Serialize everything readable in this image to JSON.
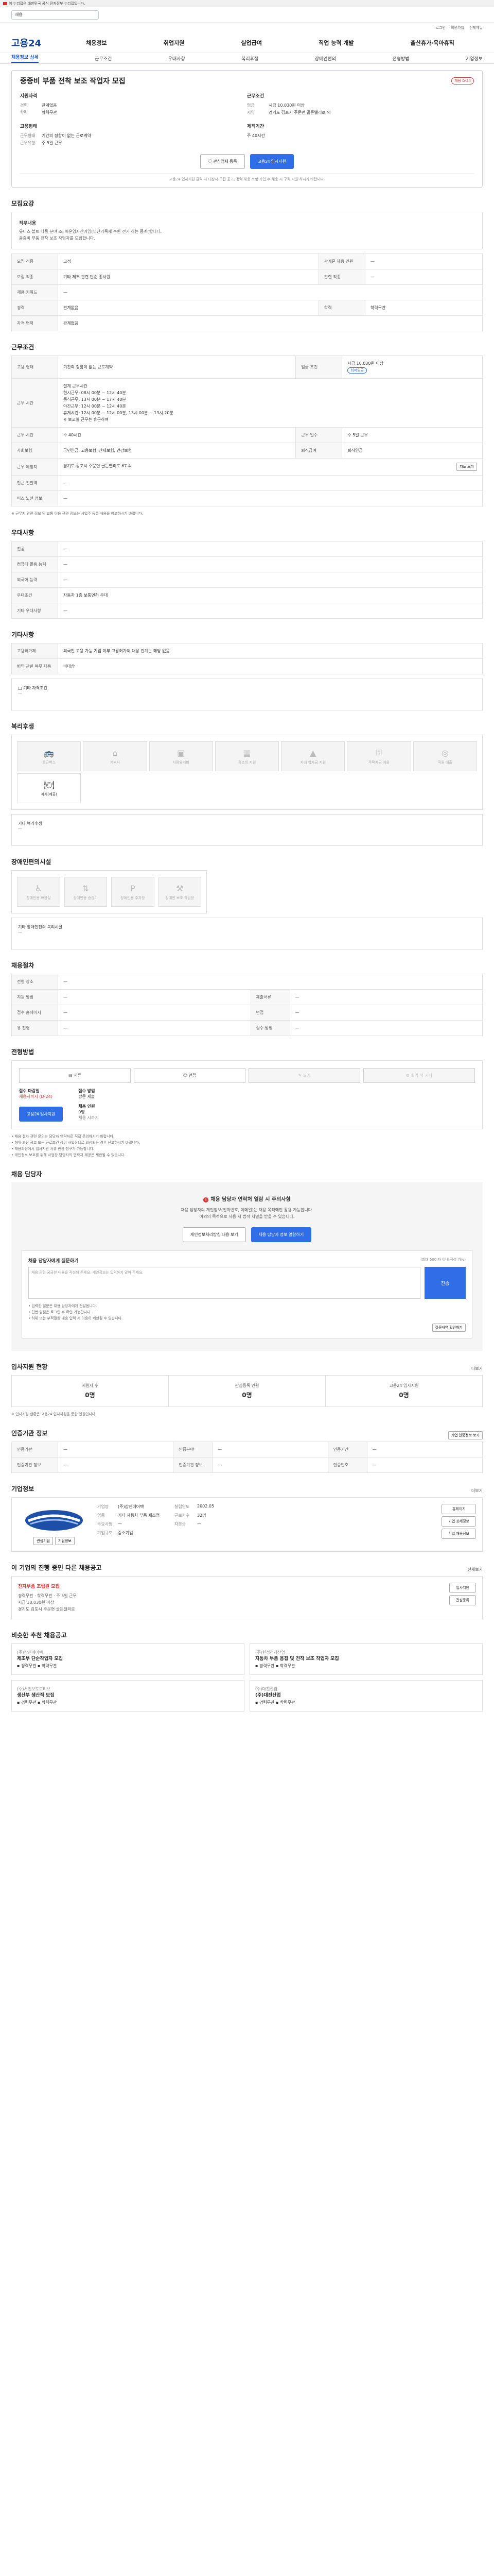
{
  "gov_notice": "이 누리집은 대한민국 공식 전자정부 누리집입니다.",
  "search": {
    "placeholder": "채용"
  },
  "util": [
    "로그인",
    "회원가입",
    "전체메뉴"
  ],
  "logo": "고용24",
  "gnb": [
    "채용정보",
    "취업지원",
    "실업급여",
    "직업 능력 개발",
    "출산휴가·육아휴직"
  ],
  "sub_tabs": [
    "채용정보 상세",
    "근무조건",
    "우대사항",
    "복리후생",
    "장애인편의",
    "전형방법",
    "기업정보"
  ],
  "job": {
    "title": "중증비 부품 전착 보조 작업자 모집",
    "badge": "채용 D-24",
    "col1_title": "지원자격",
    "exp_k": "경력",
    "exp_v": "관계없음",
    "edu_k": "학력",
    "edu_v": "학력무관",
    "form_title": "고용형태",
    "form_k": "근무형태",
    "form_v": "기간의 정함이 없는 근로계약",
    "type_k": "근무유형",
    "type_v": "주 5일 근무",
    "col2_title": "근무조건",
    "pay_k": "임금",
    "pay_v": "시급 10,030원 이상",
    "loc_k": "지역",
    "loc_v": "경기도 김포시 주문면 골든밸리로 외",
    "time_title": "제직기간",
    "time_v": "주 40시간",
    "fav_btn": "관심업체 등록",
    "apply_btn": "고용24 입사지원",
    "note": "고용24 입사지원 클릭 시 대상자 모집 공고, 경력 채용 보험 가입 후 채용 시 구직 지원 하시기 바랍니다."
  },
  "detail": {
    "title": "모집요강",
    "panel_t": "직무내용",
    "panel_p1": "유니스 볼트 다품 분야 조, 비운영자산기입(부산기록제 수한 전기 하는 중계(합니다.",
    "panel_p2": "중증비 부품 전착 보조 작업자를 모집합니다.",
    "rows": [
      {
        "k": "모집 직종",
        "v": "고정",
        "k2": "관계된 채용 인원",
        "v2": "—"
      },
      {
        "k": "모집 직종",
        "v": "기타 제조 관련 단순 종사원",
        "k2": "관련 직종",
        "v2": "—"
      },
      {
        "k": "채용 키워드",
        "v": "—",
        "k2": "",
        "v2": ""
      },
      {
        "k": "경력",
        "v": "관계없음",
        "k2": "학력",
        "v2": "학력무관"
      },
      {
        "k": "자격 면허",
        "v": "관계없음",
        "k2": "",
        "v2": ""
      }
    ]
  },
  "conditions": {
    "title": "근무조건",
    "form_k": "고용 형태",
    "form_v": "기간의 정함이 없는 근로계약",
    "pay_k": "임금 조건",
    "pay_v": "시급 10,030원 이상",
    "pay_tag": "최저임금",
    "hours_k": "근무 시간",
    "hours_lines": [
      "설계 근무시간",
      "현시근무: 08시 00분 ~ 12시 40분",
      "중식근무: 13시 00분 ~ 17시 40분",
      "야간근무: 12시 00분 ~ 12시 40분",
      "휴게시간: 12시 00분 ~ 12시 00분, 13시 00분 ~ 13시 20분",
      "※ 보교일 근무는 휴근하며"
    ],
    "weekly_k": "근무 시간",
    "weekly_v": "주 40시간",
    "days_k": "근무 일수",
    "days_v": "주 5일 근무",
    "social_k": "사회보험",
    "social_v": "국민연금, 고용보험, 산재보험, 건강보험",
    "retire_k": "퇴직급여",
    "retire_v": "퇴직연금",
    "place_k": "근무 예정지",
    "place_v": "경기도 김포시 주문면 골든밸리로 67-4",
    "map_btn": "지도 보기",
    "near_k": "인근 전철역",
    "near_v": "—",
    "bus_k": "버스 노선 정보",
    "bus_v": "—",
    "note": "※ 근무지 관련 정보 및 교통 이용 관련 정보는 사업주 등록 내용을 참고하시기 바랍니다."
  },
  "pref": {
    "title": "우대사항",
    "rows": [
      {
        "k": "전공",
        "v": "—"
      },
      {
        "k": "컴퓨터 활용 능력",
        "v": "—"
      },
      {
        "k": "외국어 능력",
        "v": "—"
      },
      {
        "k": "우대조건",
        "v": "자동차 1종 보통면허 우대"
      },
      {
        "k": "기타 우대사항",
        "v": "—"
      }
    ]
  },
  "etc": {
    "title": "기타사항",
    "rows": [
      {
        "k": "고용허가제",
        "v": "외국인 고용 가능 기업 여부 고용허가제 대상 관계는 해당 없음"
      },
      {
        "k": "병역 관련 복무 채용",
        "v": "비대상"
      }
    ],
    "check_t": "□ 기타 자격조건",
    "check_v": "—"
  },
  "benefits": {
    "title": "복리후생",
    "items": [
      "통근버스",
      "기숙사",
      "차량유지비",
      "경조비 지원",
      "자녀 학자금 지원",
      "주택자금 지원",
      "직원 대출",
      "식사(제공)"
    ],
    "active_index": 7,
    "extra_t": "기타 복리후생",
    "extra_v": "—"
  },
  "disability": {
    "title": "장애인편의시설",
    "items": [
      "장애인용 화장실",
      "장애인용 승강기",
      "장애인용 주차장",
      "장애인 보조 작업장"
    ],
    "extra_t": "기타 장애인편의 복리시설",
    "extra_v": "—"
  },
  "selection": {
    "title": "채용절차",
    "rows": [
      {
        "k": "전형 장소",
        "v": "—"
      },
      {
        "k": "지원 방법",
        "v": "—",
        "k2": "제출서류",
        "v2": "—"
      },
      {
        "k": "접수 홈페이지",
        "v": "—",
        "k2": "면접",
        "v2": "—"
      },
      {
        "k": "유 전형",
        "v": "—",
        "k2": "접수 방법",
        "v2": "—"
      }
    ]
  },
  "apply": {
    "title": "전형방법",
    "methods": [
      "서류",
      "면접",
      "필기",
      "실기 외 기타"
    ],
    "deadline_k": "접수 마감일",
    "deadline_v": "채용시까지 (D-24)",
    "process_k": "접수 방법",
    "process_v": "방문 제출",
    "period_k": "채용 시까지",
    "count_k": "채용 인원",
    "count_v": "0명",
    "apply_btn": "고용24 입사지원",
    "bullets": [
      "• 채용 절차 관련 문의는 담당자 연락처로 직접 문의하시기 바랍니다.",
      "• 허위·과장 광고 또는 근로조건 상이 사업장으로 의심되는 경우 신고하시기 바랍니다.",
      "• 채용과정에서 입사지원 서류 반환 청구가 가능합니다.",
      "• 개인정보 보호를 위해 사업장 담당자의 연락처 제공은 제한될 수 있습니다."
    ]
  },
  "manager": {
    "title": "채용 담당자",
    "alert": "채용 담당자 연락처 열람 시 주의사항",
    "desc1": "채용 담당자의 개인정보(전화번호, 이메일)는 채용 목적에만 활용 가능합니다.",
    "desc2": "이외의 목적으로 사용 시 법적 처벌을 받을 수 있습니다.",
    "btn1": "개인정보처리방침 내용 보기",
    "btn2": "채용 담당자 정보 열람하기",
    "qna_t": "채용 담당자에게 질문하기",
    "qna_help": "(최대 500 자 이내 작성 가능)",
    "qna_ph": "채용 관련 궁금한 내용을 작성해 주세요. 개인정보는 입력하지 말아 주세요.",
    "qna_btn": "전송",
    "qna_notes": [
      "• 입력한 질문은 채용 담당자에게 전달됩니다.",
      "• 답변 알림은 로그인 후 확인 가능합니다.",
      "• 허위 또는 부적절한 내용 입력 시 이용이 제한될 수 있습니다."
    ],
    "qna_bottom_btn": "질문내역 확인하기"
  },
  "stats": {
    "title": "입사지원 현황",
    "more": "더보기",
    "items": [
      {
        "l": "지원자 수",
        "n": "0명"
      },
      {
        "l": "관심등록 인원",
        "n": "0명"
      },
      {
        "l": "고용24 입사지원",
        "n": "0명"
      }
    ],
    "note": "※ 입사지원 현황은 고용24 입사지원을 통한 인원입니다."
  },
  "info": {
    "title": "인증기관 정보",
    "btn": "기업 인증정보 보기",
    "rows": [
      {
        "k": "인증기관",
        "v": "—",
        "k2": "인증분야",
        "v2": "—",
        "k3": "인증기간",
        "v3": "—"
      },
      {
        "k": "인증기관 정보",
        "v": "—",
        "k2": "인증기관 정보",
        "v2": "—",
        "k3": "인증번호",
        "v3": "—"
      }
    ]
  },
  "company": {
    "title": "기업정보",
    "more": "더보기",
    "f": [
      {
        "k": "기업명",
        "v": "(주)삼진에어텍",
        "k2": "설립연도",
        "v2": "2002.05"
      },
      {
        "k": "업종",
        "v": "기타 자동차 부품 제조업",
        "k2": "근로자수",
        "v2": "32명"
      },
      {
        "k": "주요사업",
        "v": "—",
        "k2": "자본금",
        "v2": "—"
      },
      {
        "k": "기업규모",
        "v": "중소기업",
        "k2": "",
        "v2": ""
      }
    ],
    "btns": [
      "홈페이지",
      "기업 상세정보",
      "기업 채용정보"
    ],
    "sub_btns": [
      "관심기업",
      "기업정보"
    ]
  },
  "similar": {
    "title": "이 기업의 진행 중인 다른 채용공고",
    "more": "전체보기",
    "item_t": "전자부품 조립원 모집",
    "item_meta": [
      "경력무관",
      "학력무관",
      "주 5일 근무",
      "시급 10,030원 이상",
      "경기도 김포시 주문면 골든밸리로"
    ],
    "btns": [
      "입사지원",
      "관심등록"
    ]
  },
  "recommend": {
    "title": "비슷한 추천 채용공고",
    "cards": [
      {
        "c": "(주)삼진에어텍",
        "t": "제조부 단순작업자 모집",
        "m1": "경력무관",
        "m2": "학력무관"
      },
      {
        "c": "(주)한성전자산업",
        "t": "자동차 부품 용접 및 전착 보조 작업자 모집",
        "m1": "경력무관",
        "m2": "학력무관"
      },
      {
        "c": "(주)서진오토모티브",
        "t": "생산부 생산직 모집",
        "m1": "경력무관",
        "m2": "학력무관"
      },
      {
        "c": "(주)대진산업",
        "t": "(주)대진산업",
        "m1": "경력무관",
        "m2": "학력무관"
      }
    ]
  }
}
